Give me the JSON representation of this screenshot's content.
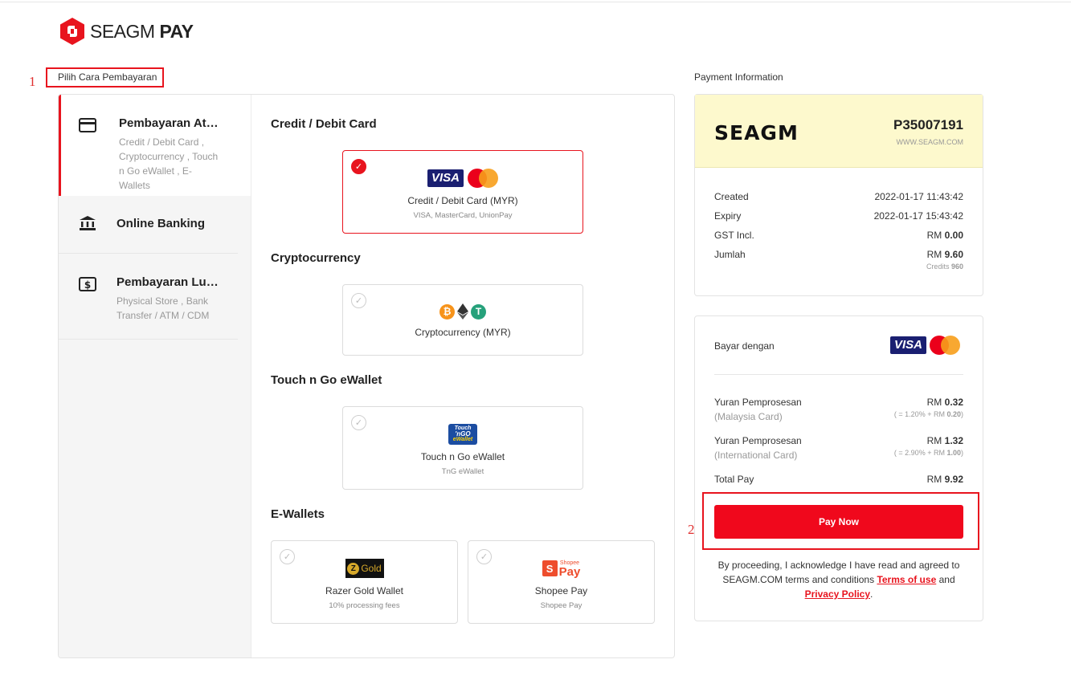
{
  "brand": {
    "name_light": "SEAGM",
    "name_bold": "PAY",
    "color": "#e8141e"
  },
  "annotations": {
    "one": "1",
    "two": "2"
  },
  "left": {
    "heading": "Pilih Cara Pembayaran",
    "sidebar": [
      {
        "title": "Pembayaran Atas Talian",
        "subtitle": "Credit / Debit Card , Cryptocurrency , Touch n Go eWallet , E-Wallets",
        "icon": "credit-card-icon",
        "active": true
      },
      {
        "title": "Online Banking",
        "subtitle": "",
        "icon": "bank-icon",
        "active": false
      },
      {
        "title": "Pembayaran Luar Talian",
        "subtitle": "Physical Store , Bank Transfer / ATM / CDM",
        "icon": "cash-icon",
        "active": false
      }
    ],
    "categories": {
      "card": "Credit / Debit Card",
      "crypto": "Cryptocurrency",
      "tng": "Touch n Go eWallet",
      "ewallets": "E-Wallets"
    },
    "methods": {
      "card": {
        "name": "Credit / Debit Card (MYR)",
        "sub": "VISA, MasterCard, UnionPay",
        "selected": true
      },
      "crypto": {
        "name": "Cryptocurrency (MYR)",
        "sub": ""
      },
      "tng": {
        "name": "Touch n Go eWallet",
        "sub": "TnG eWallet",
        "logo_l1": "Touch",
        "logo_l2": "'nGO",
        "logo_l3": "eWallet"
      },
      "razer": {
        "name": "Razer Gold Wallet",
        "sub": "10% processing fees",
        "logo_text": "Gold"
      },
      "shopee": {
        "name": "Shopee Pay",
        "sub": "Shopee Pay",
        "logo_small": "Shopee",
        "logo_big": "Pay"
      }
    },
    "visa_label": "VISA"
  },
  "right": {
    "heading": "Payment Information",
    "order": {
      "brand": "SEAGM",
      "id": "P35007191",
      "site": "WWW.SEAGM.COM",
      "created_label": "Created",
      "created": "2022-01-17 11:43:42",
      "expiry_label": "Expiry",
      "expiry": "2022-01-17 15:43:42",
      "gst_label": "GST Incl.",
      "gst_cur": "RM",
      "gst": "0.00",
      "jumlah_label": "Jumlah",
      "jumlah_cur": "RM",
      "jumlah": "9.60",
      "credits_label": "Credits",
      "credits": "960"
    },
    "payment": {
      "pay_with": "Bayar dengan",
      "fee1_label": "Yuran Pemprosesan",
      "fee1_sub": "(Malaysia Card)",
      "fee1_cur": "RM",
      "fee1": "0.32",
      "fee1_formula_pre": "( = 1.20% + RM",
      "fee1_formula_val": "0.20",
      "fee1_formula_post": ")",
      "fee2_label": "Yuran Pemprosesan",
      "fee2_sub": "(International Card)",
      "fee2_cur": "RM",
      "fee2": "1.32",
      "fee2_formula_pre": "( = 2.90% + RM",
      "fee2_formula_val": "1.00",
      "fee2_formula_post": ")",
      "total_label": "Total Pay",
      "total_cur": "RM",
      "total": "9.92",
      "button": "Pay Now",
      "terms_pre": "By proceeding, I acknowledge I have read and agreed to SEAGM.COM terms and conditions",
      "terms_link": "Terms of use",
      "terms_and": "and",
      "privacy_link": "Privacy Policy",
      "terms_end": "."
    }
  }
}
